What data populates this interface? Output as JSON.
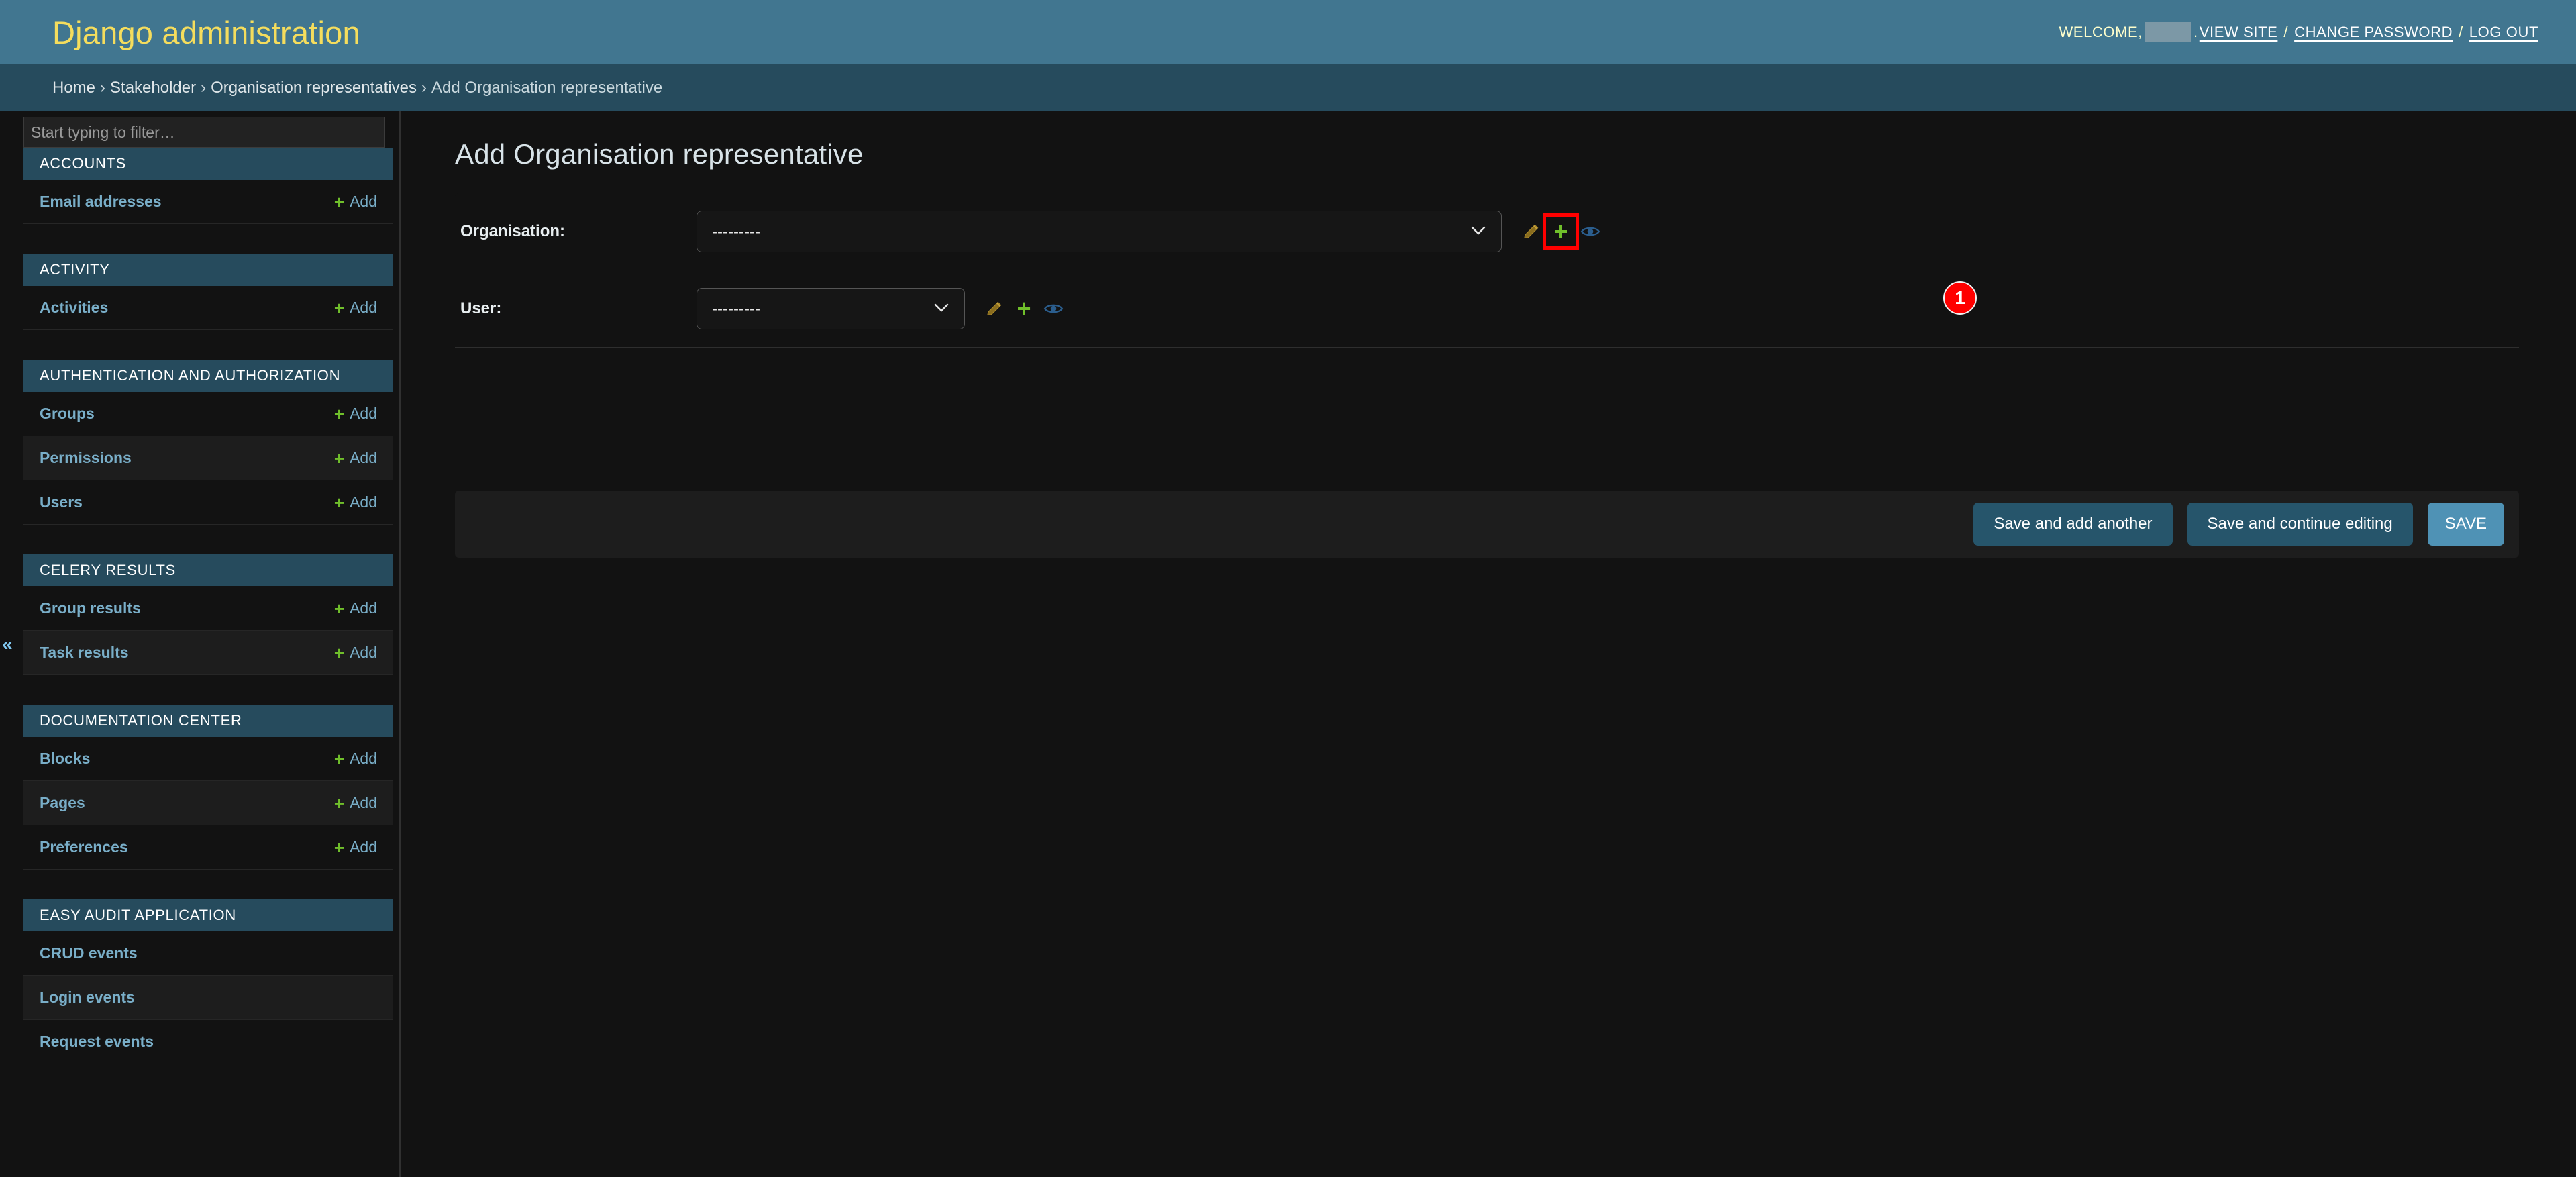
{
  "branding": {
    "site_title": "Django administration",
    "welcome_text": "WELCOME,",
    "username_redacted": "",
    "punct_after_user": ".",
    "view_site": "VIEW SITE",
    "change_password": "CHANGE PASSWORD",
    "log_out": "LOG OUT",
    "separator": "/"
  },
  "breadcrumbs": {
    "separator": "›",
    "items": [
      {
        "label": "Home",
        "link": true
      },
      {
        "label": "Stakeholder",
        "link": true
      },
      {
        "label": "Organisation representatives",
        "link": true
      },
      {
        "label": "Add Organisation representative",
        "link": false
      }
    ]
  },
  "sidebar": {
    "filter_placeholder": "Start typing to filter…",
    "filter_value": "",
    "collapse_glyph": "«",
    "add_label": "Add",
    "plus_glyph": "+",
    "apps": [
      {
        "caption": "ACCOUNTS",
        "models": [
          {
            "name": "Email addresses",
            "add": true
          }
        ]
      },
      {
        "caption": "ACTIVITY",
        "models": [
          {
            "name": "Activities",
            "add": true
          }
        ]
      },
      {
        "caption": "AUTHENTICATION AND AUTHORIZATION",
        "models": [
          {
            "name": "Groups",
            "add": true
          },
          {
            "name": "Permissions",
            "add": true
          },
          {
            "name": "Users",
            "add": true
          }
        ]
      },
      {
        "caption": "CELERY RESULTS",
        "models": [
          {
            "name": "Group results",
            "add": true
          },
          {
            "name": "Task results",
            "add": true
          }
        ]
      },
      {
        "caption": "DOCUMENTATION CENTER",
        "models": [
          {
            "name": "Blocks",
            "add": true
          },
          {
            "name": "Pages",
            "add": true
          },
          {
            "name": "Preferences",
            "add": true
          }
        ]
      },
      {
        "caption": "EASY AUDIT APPLICATION",
        "models": [
          {
            "name": "CRUD events",
            "add": false
          },
          {
            "name": "Login events",
            "add": false
          },
          {
            "name": "Request events",
            "add": false
          }
        ]
      }
    ]
  },
  "content": {
    "title": "Add Organisation representative",
    "form": {
      "rows": [
        {
          "label": "Organisation:",
          "select_id": "id-organisation",
          "selected": "---------",
          "options": [
            "---------"
          ],
          "chevron": "⌄",
          "icons": [
            {
              "name": "change-related",
              "type": "pencil",
              "highlighted": false
            },
            {
              "name": "add-related",
              "type": "plus",
              "highlighted": true
            },
            {
              "name": "view-related",
              "type": "eye",
              "highlighted": false
            }
          ]
        },
        {
          "label": "User:",
          "select_id": "id-user",
          "selected": "---------",
          "options": [
            "---------"
          ],
          "chevron": "⌄",
          "icons": [
            {
              "name": "change-related",
              "type": "pencil",
              "highlighted": false
            },
            {
              "name": "add-related",
              "type": "plus",
              "highlighted": false
            },
            {
              "name": "view-related",
              "type": "eye",
              "highlighted": false
            }
          ]
        }
      ]
    },
    "submit_row": {
      "save_and_add_another": "Save and add another",
      "save_and_continue": "Save and continue editing",
      "save": "SAVE"
    }
  },
  "annotation": {
    "badge_number": "1",
    "badge_color": "#ff0000",
    "highlight_color": "#ff0000"
  },
  "colors": {
    "header_bg": "#417690",
    "breadcrumb_bg": "#264b5d",
    "page_bg": "#121212",
    "brand_yellow": "#f5dd5d",
    "link_blue": "#79aec8",
    "add_green": "#70bf2b",
    "button_blue": "#26556b",
    "button_default": "#4f92b5"
  }
}
